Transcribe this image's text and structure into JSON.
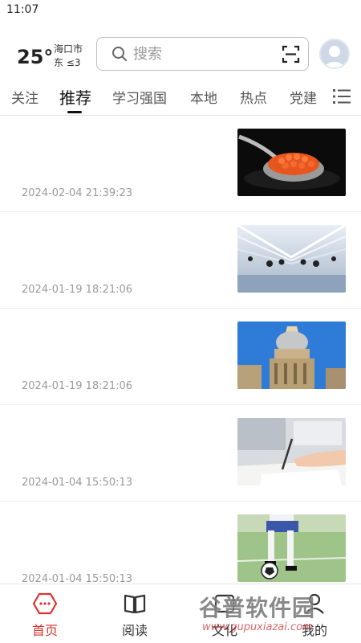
{
  "status_bar": {
    "time": "11:07"
  },
  "header": {
    "temperature": "25°",
    "city": "海口市",
    "wind": "东  ≤3",
    "search_placeholder": "搜索"
  },
  "tabs": [
    {
      "label": "关注",
      "active": false
    },
    {
      "label": "推荐",
      "active": true
    },
    {
      "label": "学习强国",
      "active": false
    },
    {
      "label": "本地",
      "active": false
    },
    {
      "label": "热点",
      "active": false
    },
    {
      "label": "党建",
      "active": false
    }
  ],
  "feed": [
    {
      "date": "2024-02-04 21:39:23",
      "image": "caviar-spoon"
    },
    {
      "date": "2024-01-19 18:21:06",
      "image": "futuristic-hall"
    },
    {
      "date": "2024-01-19 18:21:06",
      "image": "radcliffe-camera"
    },
    {
      "date": "2024-01-04 15:50:13",
      "image": "writing-hand"
    },
    {
      "date": "2024-01-04 15:50:13",
      "image": "football-player"
    }
  ],
  "bottom_nav": [
    {
      "label": "首页",
      "icon": "home-hexagon-icon",
      "active": true
    },
    {
      "label": "阅读",
      "icon": "book-icon",
      "active": false
    },
    {
      "label": "文化",
      "icon": "culture-icon",
      "active": false
    },
    {
      "label": "我的",
      "icon": "profile-icon",
      "active": false
    }
  ],
  "watermark": {
    "title": "谷普软件园",
    "url": "www.gupuxiazai.com"
  },
  "colors": {
    "accent": "#d9322f",
    "text": "#222222",
    "muted": "#9a9a9a"
  }
}
